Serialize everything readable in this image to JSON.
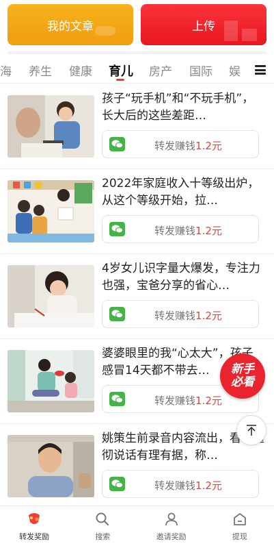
{
  "top_actions": {
    "my_articles": "我的文章",
    "upload": "上传"
  },
  "tabs": [
    {
      "label": "海",
      "active": false
    },
    {
      "label": "养生",
      "active": false
    },
    {
      "label": "健康",
      "active": false
    },
    {
      "label": "育儿",
      "active": true
    },
    {
      "label": "房产",
      "active": false
    },
    {
      "label": "国际",
      "active": false
    },
    {
      "label": "娱",
      "active": false
    }
  ],
  "articles": [
    {
      "title": "孩子“玩手机”和“不玩手机”，长大后的这些差距…",
      "share_label": "转发赚钱",
      "share_amount": "1.2元"
    },
    {
      "title": "2022年家庭收入十等级出炉，从这个等级开始，拉…",
      "share_label": "转发赚钱",
      "share_amount": "1.2元"
    },
    {
      "title": "4岁女儿识字量大爆发，专注力也强，宝爸分享的省心…",
      "share_label": "转发赚钱",
      "share_amount": "1.2元"
    },
    {
      "title": "婆婆眼里的我“心太大”，孩子感冒14天都不带去…",
      "share_label": "转发赚钱",
      "share_amount": "1.2元"
    },
    {
      "title": "姚策生前录音内容流出，看事透彻说话有理有据，称…",
      "share_label": "转发赚钱",
      "share_amount": "1.2元"
    }
  ],
  "floating": {
    "badge_line1": "新手",
    "badge_line2": "必看"
  },
  "bottom_nav": [
    {
      "label": "转发奖励",
      "icon": "share-reward-icon",
      "active": true
    },
    {
      "label": "搜索",
      "icon": "search-icon",
      "active": false
    },
    {
      "label": "邀请奖励",
      "icon": "invite-user-icon",
      "active": false
    },
    {
      "label": "提现",
      "icon": "withdraw-icon",
      "active": false
    }
  ],
  "colors": {
    "accent_red": "#e8242f",
    "orange": "#f19d10",
    "wechat_green": "#47b249",
    "amount_red": "#e64234"
  }
}
